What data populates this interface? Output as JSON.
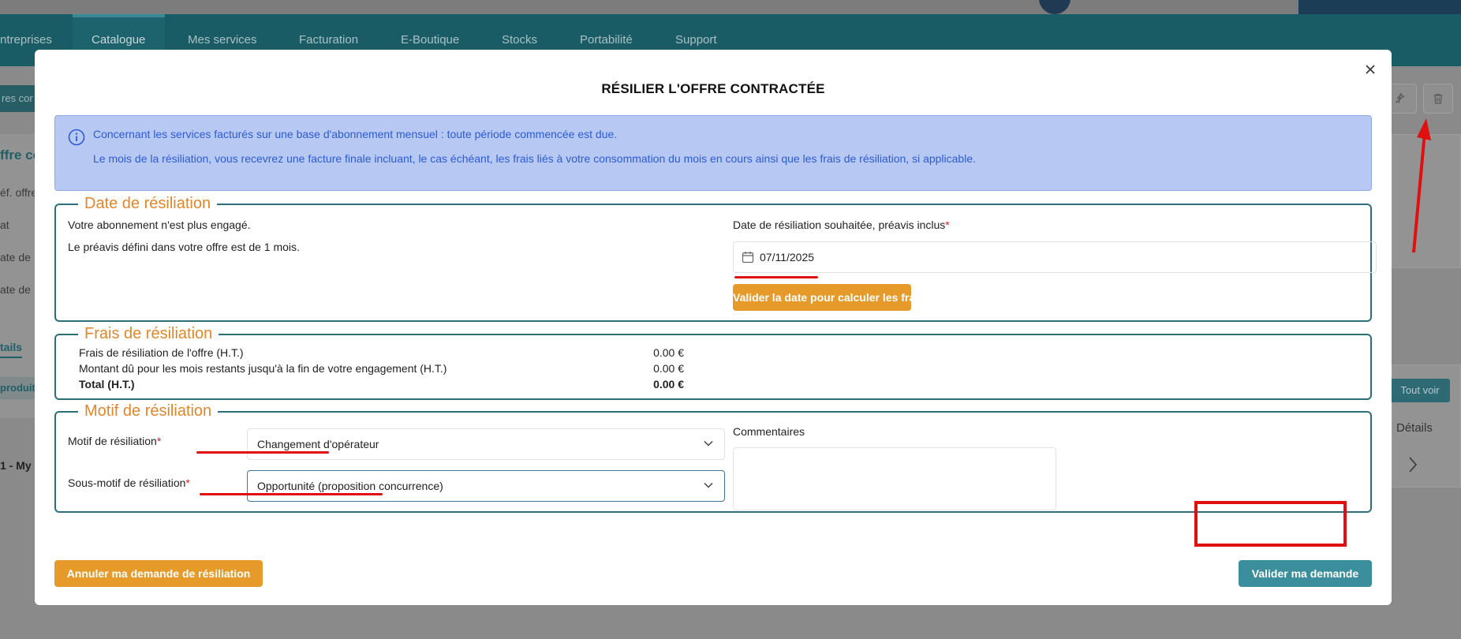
{
  "nav": {
    "items": [
      "ntreprises",
      "Catalogue",
      "Mes services",
      "Facturation",
      "E-Boutique",
      "Stocks",
      "Portabilité",
      "Support"
    ],
    "active": "Catalogue"
  },
  "background": {
    "left_button": "res cor",
    "left_title": "ffre co",
    "left_rows": [
      "éf. offre",
      "at",
      "ate de",
      "ate de"
    ],
    "left_tab": "tails",
    "left_row_header": "produit",
    "left_line": "1 - My",
    "tout_voir": "Tout voir",
    "details": "Détails"
  },
  "modal": {
    "title": "RÉSILIER L'OFFRE CONTRACTÉE",
    "info_lines": [
      "Concernant les services facturés sur une base d'abonnement mensuel : toute période commencée est due.",
      "Le mois de la résiliation, vous recevrez une facture finale incluant, le cas échéant, les frais liés à votre consommation du mois en cours ainsi que les frais de résiliation, si applicable."
    ],
    "date_section": {
      "legend": "Date de résiliation",
      "line1": "Votre abonnement n'est plus engagé.",
      "line2": "Le préavis défini dans votre offre est de 1 mois.",
      "date_label": "Date de résiliation souhaitée, préavis inclus",
      "date_value": "07/11/2025",
      "validate_date_button": "Valider la date pour calculer les frais"
    },
    "fees_section": {
      "legend": "Frais de résiliation",
      "rows": [
        {
          "label": "Frais de résiliation de l'offre (H.T.)",
          "amount": "0.00 €"
        },
        {
          "label": "Montant dû pour les mois restants jusqu'à la fin de votre engagement (H.T.)",
          "amount": "0.00 €"
        },
        {
          "label": "Total (H.T.)",
          "amount": "0.00 €"
        }
      ]
    },
    "reason_section": {
      "legend": "Motif de résiliation",
      "reason_label": "Motif de résiliation",
      "reason_value": "Changement d'opérateur",
      "subreason_label": "Sous-motif de résiliation",
      "subreason_value": "Opportunité (proposition concurrence)",
      "comments_label": "Commentaires",
      "comments_value": ""
    },
    "cancel_button": "Annuler ma demande de résiliation",
    "submit_button": "Valider ma demande",
    "required_mark": "*"
  },
  "colors": {
    "orange": "#e59a2a",
    "teal": "#3b8e9b",
    "info_bg": "#b7c9f2",
    "info_text": "#2b5bd6",
    "annotation_red": "#e01010"
  }
}
